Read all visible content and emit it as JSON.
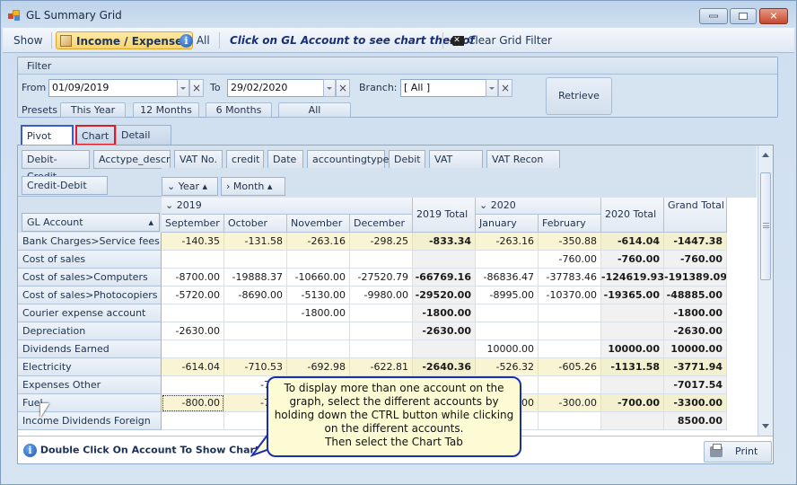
{
  "window": {
    "title": "GL Summary Grid",
    "icon": "app-grid-icon",
    "controls": [
      "minimize",
      "maximize",
      "close"
    ]
  },
  "toolbar": {
    "show_label": "Show",
    "income_expenses_label": "Income / Expenses",
    "all_label": "All",
    "hint": "Click on GL Account to see chart thereof",
    "clear_filter_label": "Clear Grid Filter"
  },
  "filter": {
    "title": "Filter",
    "from_label": "From",
    "from_value": "01/09/2019",
    "to_label": "To",
    "to_value": "29/02/2020",
    "branch_label": "Branch:",
    "branch_value": "[ All ]",
    "presets_label": "Presets",
    "presets": [
      "This Year",
      "12 Months",
      "6 Months",
      "All"
    ],
    "retrieve_label": "Retrieve"
  },
  "tabs": [
    {
      "label": "Pivot Grid",
      "active": true
    },
    {
      "label": "Chart",
      "highlighted": true
    },
    {
      "label": "Detail Grid"
    }
  ],
  "pivot": {
    "filter_fields": [
      "Debit-Credit",
      "Acctype_descr",
      "VAT No.",
      "credit",
      "Date",
      "accountingtype",
      "Debit",
      "VAT Amt.",
      "VAT Recon No."
    ],
    "data_field": "Credit-Debit",
    "column_fields": [
      "Year",
      "Month"
    ],
    "row_field": "GL Account",
    "year_2019": "2019",
    "year_2020": "2020",
    "months_2019": [
      "September",
      "October",
      "November",
      "December"
    ],
    "total_2019": "2019 Total",
    "months_2020": [
      "January",
      "February"
    ],
    "total_2020": "2020 Total",
    "grand_total": "Grand Total",
    "rows": [
      {
        "account": "Bank Charges>Service fees",
        "values": [
          "-140.35",
          "-131.58",
          "-263.16",
          "-298.25",
          "-833.34",
          "-263.16",
          "-350.88",
          "-614.04",
          "-1447.38"
        ],
        "highlight": true
      },
      {
        "account": "Cost of sales",
        "values": [
          "",
          "",
          "",
          "",
          "",
          "",
          "-760.00",
          "-760.00",
          "-760.00"
        ]
      },
      {
        "account": "Cost of sales>Computers",
        "values": [
          "-8700.00",
          "-19888.37",
          "-10660.00",
          "-27520.79",
          "-66769.16",
          "-86836.47",
          "-37783.46",
          "-124619.93",
          "-191389.09"
        ]
      },
      {
        "account": "Cost of sales>Photocopiers",
        "values": [
          "-5720.00",
          "-8690.00",
          "-5130.00",
          "-9980.00",
          "-29520.00",
          "-8995.00",
          "-10370.00",
          "-19365.00",
          "-48885.00"
        ]
      },
      {
        "account": "Courier expense account",
        "values": [
          "",
          "",
          "-1800.00",
          "",
          "-1800.00",
          "",
          "",
          "",
          "-1800.00"
        ]
      },
      {
        "account": "Depreciation",
        "values": [
          "-2630.00",
          "",
          "",
          "",
          "-2630.00",
          "",
          "",
          "",
          "-2630.00"
        ]
      },
      {
        "account": "Dividends Earned",
        "values": [
          "",
          "",
          "",
          "",
          "",
          "10000.00",
          "",
          "10000.00",
          "10000.00"
        ]
      },
      {
        "account": "Electricity",
        "values": [
          "-614.04",
          "-710.53",
          "-692.98",
          "-622.81",
          "-2640.36",
          "-526.32",
          "-605.26",
          "-1131.58",
          "-3771.94"
        ],
        "highlight": true
      },
      {
        "account": "Expenses Other",
        "values": [
          "",
          "-701",
          "",
          "",
          "",
          "",
          "",
          "",
          "-7017.54"
        ]
      },
      {
        "account": "Fuel",
        "values": [
          "-800.00",
          "-700",
          "",
          "",
          "",
          ".00",
          "-300.00",
          "-700.00",
          "-3300.00"
        ],
        "highlight": true
      },
      {
        "account": "Income Dividends Foreign",
        "values": [
          "",
          "",
          "",
          "",
          "",
          "",
          "",
          "",
          "8500.00"
        ]
      }
    ]
  },
  "footer": {
    "info": "Double Click On Account To Show Chart",
    "print_label": "Print"
  },
  "callout": {
    "lines": [
      "To display more than one account on the",
      "graph, select the different accounts by",
      "holding down the CTRL button while clicking",
      "on the different accounts.",
      "Then select the Chart Tab"
    ]
  }
}
